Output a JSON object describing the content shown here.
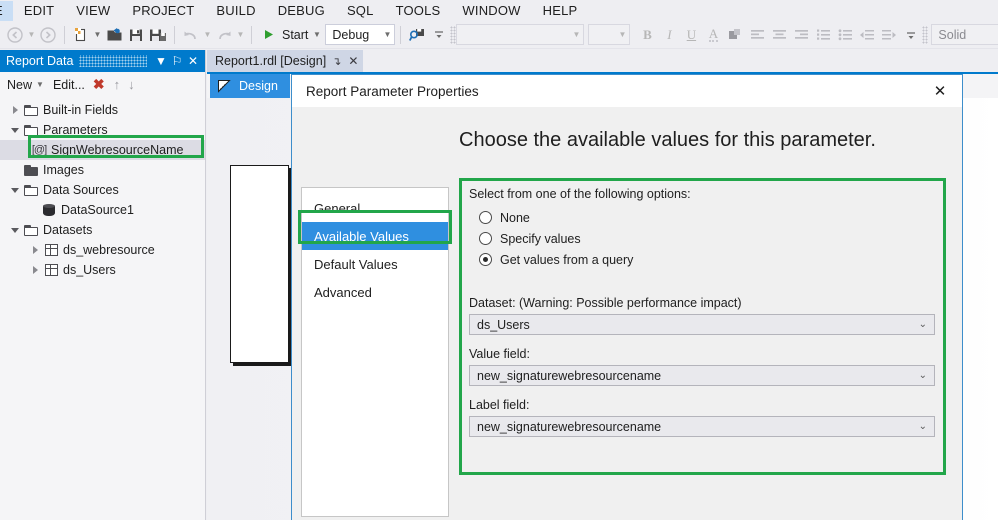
{
  "menubar": {
    "items": [
      {
        "label": "E",
        "name": "menu-file",
        "clipped": true
      },
      {
        "label": "EDIT",
        "name": "menu-edit"
      },
      {
        "label": "VIEW",
        "name": "menu-view"
      },
      {
        "label": "PROJECT",
        "name": "menu-project"
      },
      {
        "label": "BUILD",
        "name": "menu-build"
      },
      {
        "label": "DEBUG",
        "name": "menu-debug"
      },
      {
        "label": "SQL",
        "name": "menu-sql"
      },
      {
        "label": "TOOLS",
        "name": "menu-tools"
      },
      {
        "label": "WINDOW",
        "name": "menu-window"
      },
      {
        "label": "HELP",
        "name": "menu-help"
      }
    ]
  },
  "toolbar": {
    "start_label": "Start",
    "config_value": "Debug",
    "style_value": "Solid",
    "font_name_value": "",
    "font_size_value": "",
    "bold_label": "B",
    "italic_label": "I",
    "underline_label": "U",
    "font_color_label": "A"
  },
  "report_data": {
    "title": "Report Data",
    "new_label": "New",
    "edit_label": "Edit...",
    "delete_label": "✖",
    "move_up_label": "↑",
    "move_down_label": "↓",
    "auto_hide_label": "⚐",
    "close_label": "✕",
    "tree": [
      {
        "label": "Built-in Fields",
        "name": "tree-built-in-fields",
        "indent": 0,
        "twisty": "closed",
        "icon": "folder-icon"
      },
      {
        "label": "Parameters",
        "name": "tree-parameters",
        "indent": 0,
        "twisty": "open",
        "icon": "folder-icon"
      },
      {
        "label": "SignWebresourceName",
        "name": "tree-parameter-signwebresourcename",
        "indent": 1,
        "twisty": "none",
        "icon": "parameter-icon",
        "selected": true,
        "highlighted": true
      },
      {
        "label": "Images",
        "name": "tree-images",
        "indent": 0,
        "twisty": "none",
        "icon": "folder-icon"
      },
      {
        "label": "Data Sources",
        "name": "tree-data-sources",
        "indent": 0,
        "twisty": "open",
        "icon": "folder-icon"
      },
      {
        "label": "DataSource1",
        "name": "tree-datasource1",
        "indent": 1,
        "twisty": "none",
        "icon": "database-icon"
      },
      {
        "label": "Datasets",
        "name": "tree-datasets",
        "indent": 0,
        "twisty": "open",
        "icon": "folder-icon"
      },
      {
        "label": "ds_webresource",
        "name": "tree-dataset-ds-webresource",
        "indent": 1,
        "twisty": "closed",
        "icon": "table-icon"
      },
      {
        "label": "ds_Users",
        "name": "tree-dataset-ds-users",
        "indent": 1,
        "twisty": "closed",
        "icon": "table-icon"
      }
    ]
  },
  "document": {
    "tab_label": "Report1.rdl [Design]",
    "pin_label": "↴",
    "close_label": "✕",
    "design_tab_label": "Design"
  },
  "dialog": {
    "title": "Report Parameter Properties",
    "close_label": "✕",
    "nav": [
      {
        "label": "General",
        "name": "dialog-nav-general",
        "active": false
      },
      {
        "label": "Available Values",
        "name": "dialog-nav-available-values",
        "active": true,
        "highlighted": true
      },
      {
        "label": "Default Values",
        "name": "dialog-nav-default-values",
        "active": false
      },
      {
        "label": "Advanced",
        "name": "dialog-nav-advanced",
        "active": false
      }
    ],
    "heading": "Choose the available values for this parameter.",
    "options_label": "Select from one of the following options:",
    "radios": [
      {
        "label": "None",
        "name": "radio-none",
        "checked": false
      },
      {
        "label": "Specify values",
        "name": "radio-specify-values",
        "checked": false
      },
      {
        "label": "Get values from a query",
        "name": "radio-get-values-from-query",
        "checked": true
      }
    ],
    "dataset_label": "Dataset: (Warning: Possible performance impact)",
    "dataset_value": "ds_Users",
    "value_field_label": "Value field:",
    "value_field_value": "new_signaturewebresourcename",
    "label_field_label": "Label field:",
    "label_field_value": "new_signaturewebresourcename",
    "caret_glyph": "⌄"
  },
  "colors": {
    "accent_blue": "#007acc",
    "highlight_green": "#22a64a",
    "selected_nav_blue": "#2f8fe0",
    "delete_red": "#c0392b",
    "start_green": "#2f9e2f"
  }
}
